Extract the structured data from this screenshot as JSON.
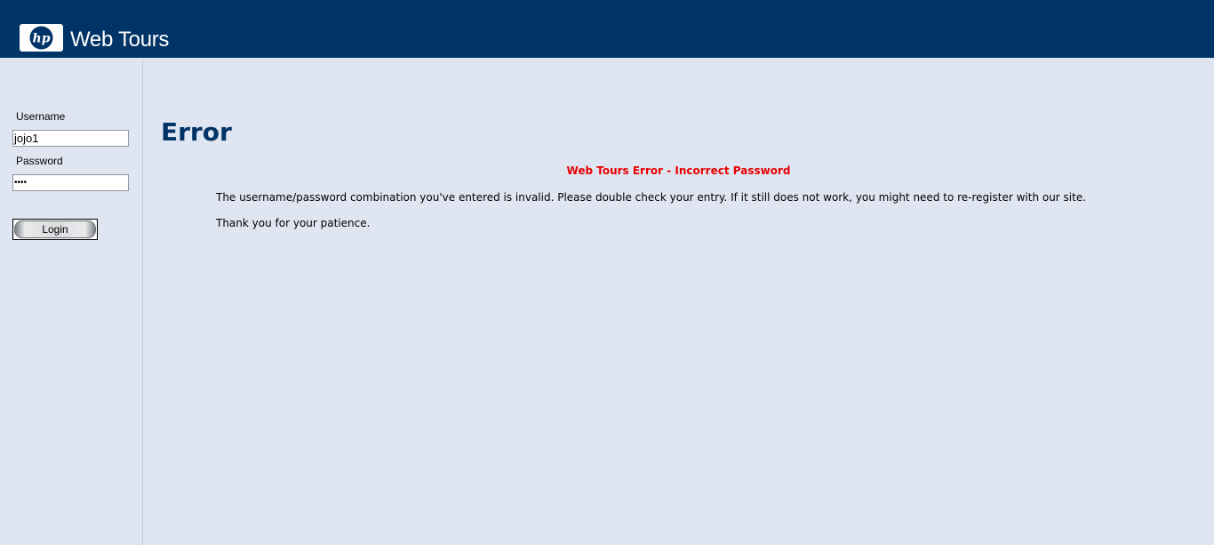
{
  "header": {
    "logo_text": "hp",
    "site_title": "Web Tours"
  },
  "sidebar": {
    "username_label": "Username",
    "username_value": "jojo1",
    "password_label": "Password",
    "password_value": "••••",
    "login_label": "Login"
  },
  "main": {
    "title": "Error",
    "error_heading": "Web Tours Error - Incorrect Password",
    "message": "The username/password combination you've entered is invalid. Please double check your entry. If it still does not work, you might need to re-register with our site.",
    "thanks": "Thank you for your patience."
  },
  "colors": {
    "header_bg": "#003366",
    "page_bg": "#e0e6f1",
    "title": "#003366",
    "error": "#e60000"
  }
}
